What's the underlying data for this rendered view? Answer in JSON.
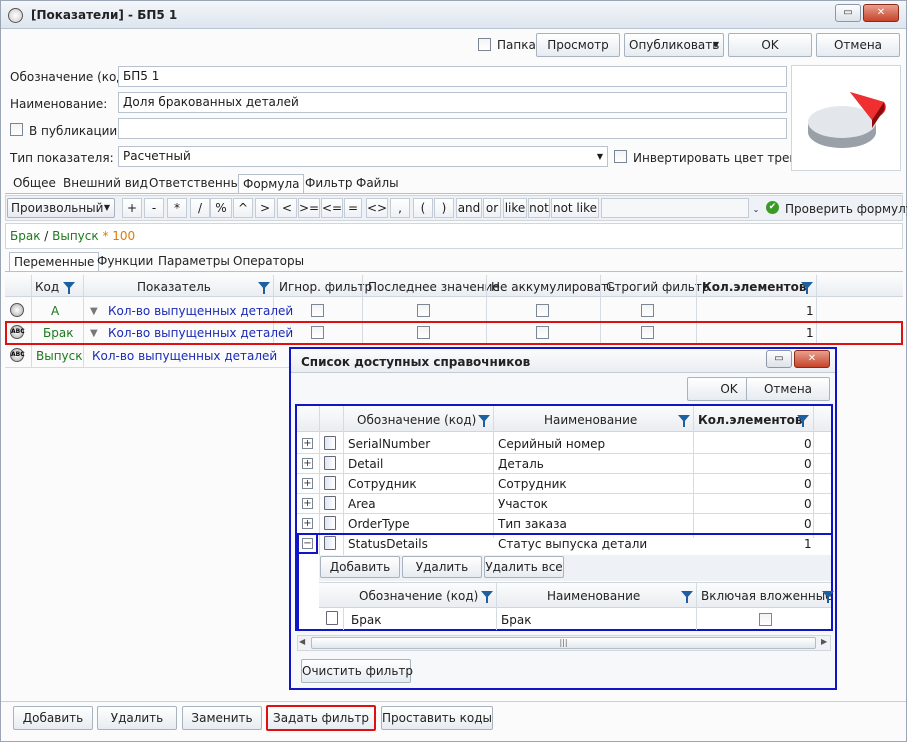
{
  "window": {
    "title": "[Показатели] - БП5 1"
  },
  "toolbar": {
    "folder_label": "Папка",
    "view": "Просмотр",
    "publish": "Опубликовать",
    "ok": "OK",
    "cancel": "Отмена"
  },
  "form": {
    "code_label": "Обозначение (код):",
    "code_value": "БП5 1",
    "name_label": "Наименование:",
    "name_value": "Доля бракованных деталей",
    "publication_label": "В публикации:",
    "type_label": "Тип показателя:",
    "type_value": "Расчетный",
    "invert_label": "Инвертировать цвет тренда"
  },
  "tabs": [
    "Общее",
    "Внешний вид",
    "Ответственные",
    "Формула",
    "Фильтр",
    "Файлы"
  ],
  "formula_toolbar": {
    "mode": "Произвольный",
    "ops": [
      "+",
      "-",
      "*",
      "/",
      "%",
      "^",
      ">",
      "<",
      ">=",
      "<=",
      "=",
      "<>",
      ",",
      "(",
      ")",
      "and",
      "or",
      "like",
      "not",
      "not like"
    ],
    "check": "Проверить формулу"
  },
  "formula": {
    "part1": "Брак",
    "sep": " / ",
    "part2": "Выпуск",
    "part3": " * 100"
  },
  "subtabs": [
    "Переменные",
    "Функции",
    "Параметры",
    "Операторы"
  ],
  "grid": {
    "headers": [
      "Код",
      "Показатель",
      "Игнор. фильтр",
      "Последнее значение",
      "Не аккумулировать",
      "Строгий фильтр",
      "Кол.элементов"
    ],
    "rows": [
      {
        "code": "A",
        "indicator": "Кол-во выпущенных деталей",
        "count": "1"
      },
      {
        "code": "Брак",
        "indicator": "Кол-во выпущенных деталей",
        "count": "1"
      },
      {
        "code": "Выпуск",
        "indicator": "Кол-во выпущенных деталей",
        "count": ""
      }
    ]
  },
  "dialog": {
    "title": "Список доступных справочников",
    "ok": "OK",
    "cancel": "Отмена",
    "headers": [
      "Обозначение (код)",
      "Наименование",
      "Кол.элементов"
    ],
    "rows": [
      {
        "code": "SerialNumber",
        "name": "Серийный номер",
        "count": "0"
      },
      {
        "code": "Detail",
        "name": "Деталь",
        "count": "0"
      },
      {
        "code": "Сотрудник",
        "name": "Сотрудник",
        "count": "0"
      },
      {
        "code": "Area",
        "name": "Участок",
        "count": "0"
      },
      {
        "code": "OrderType",
        "name": "Тип заказа",
        "count": "0"
      },
      {
        "code": "StatusDetails",
        "name": "Статус выпуска детали",
        "count": "1"
      }
    ],
    "sub_buttons": [
      "Добавить",
      "Удалить",
      "Удалить все"
    ],
    "sub_headers": [
      "Обозначение (код)",
      "Наименование",
      "Включая вложенные"
    ],
    "sub_rows": [
      {
        "code": "Брак",
        "name": "Брак"
      }
    ],
    "clear_filter": "Очистить фильтр",
    "scroll_grip": "|||"
  },
  "bottom": {
    "add": "Добавить",
    "delete": "Удалить",
    "replace": "Заменить",
    "set_filter": "Задать фильтр",
    "set_codes": "Проставить коды"
  },
  "colors": {
    "highlight_red": "#e01010",
    "highlight_blue": "#1016c8",
    "formula_green": "#1c7a1c",
    "link_blue": "#1a2ab8"
  }
}
